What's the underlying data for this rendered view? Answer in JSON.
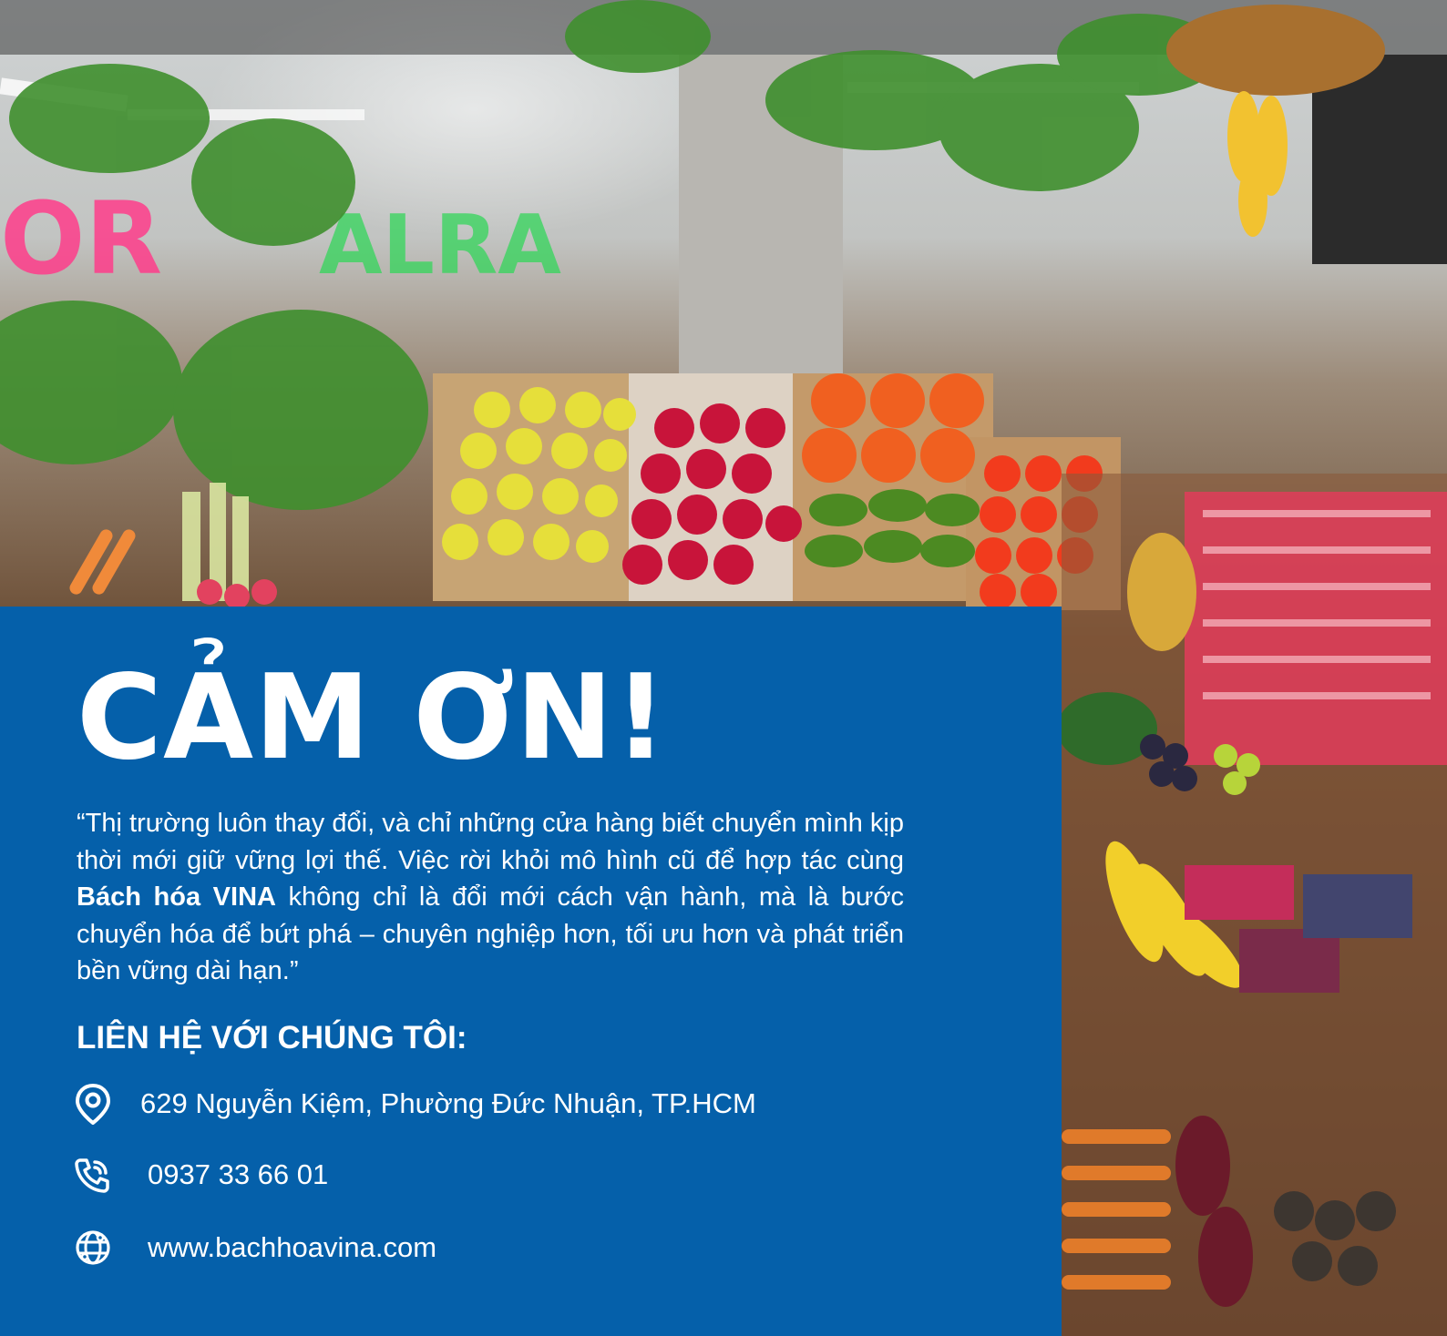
{
  "background": {
    "description_icon": "market-produce-photo",
    "panel_color": "#0560aa"
  },
  "panel": {
    "title": "CẢM ƠN!",
    "quote_before": "“Thị trường luôn thay đổi, và chỉ những cửa hàng biết chuyển mình kịp thời mới giữ vững lợi thế. Việc rời khỏi mô hình cũ để hợp tác cùng ",
    "quote_brand": "Bách hóa VINA",
    "quote_after": " không chỉ là đổi mới cách vận hành, mà là bước chuyển hóa để bứt phá – chuyên nghiệp hơn, tối ưu hơn và phát triển bền vững dài hạn.”",
    "contact_heading": "LIÊN HỆ VỚI CHÚNG TÔI:",
    "contacts": [
      {
        "icon": "location-pin-icon",
        "text": "629 Nguyễn Kiệm, Phường Đức Nhuận, TP.HCM"
      },
      {
        "icon": "phone-icon",
        "text": "0937 33 66 01"
      },
      {
        "icon": "globe-icon",
        "text": "www.bachhoavina.com"
      }
    ]
  }
}
